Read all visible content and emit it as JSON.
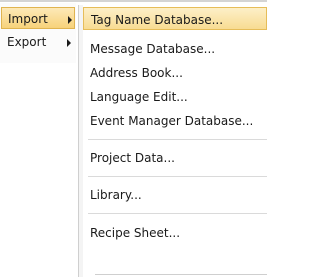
{
  "left_menu": {
    "items": [
      {
        "label": "Import",
        "has_submenu": true,
        "active": true
      },
      {
        "label": "Export",
        "has_submenu": true,
        "active": false
      }
    ]
  },
  "submenu": {
    "items": [
      {
        "label": "Tag Name Database..."
      },
      {
        "label": "Message Database..."
      },
      {
        "label": "Address Book..."
      },
      {
        "label": "Language Edit..."
      },
      {
        "label": "Event Manager Database..."
      },
      {
        "label": "Project Data..."
      },
      {
        "label": "Library..."
      },
      {
        "label": "Recipe Sheet..."
      }
    ]
  },
  "colors": {
    "highlight": "#f7d27a",
    "highlight_border": "#e0b450"
  }
}
